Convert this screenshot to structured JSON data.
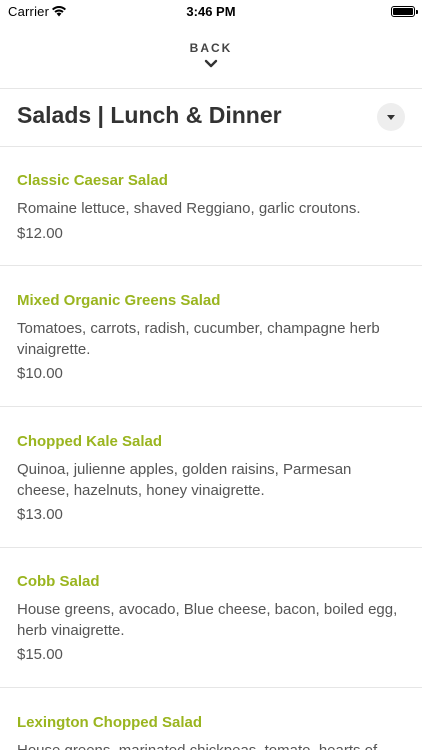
{
  "status_bar": {
    "carrier": "Carrier",
    "time": "3:46 PM"
  },
  "nav": {
    "back_label": "BACK"
  },
  "section": {
    "title": "Salads | Lunch & Dinner"
  },
  "menu_items": [
    {
      "name": "Classic Caesar Salad",
      "description": "Romaine lettuce, shaved Reggiano, garlic croutons.",
      "price": "$12.00"
    },
    {
      "name": "Mixed Organic Greens Salad",
      "description": "Tomatoes, carrots, radish, cucumber, champagne herb vinaigrette.",
      "price": "$10.00"
    },
    {
      "name": "Chopped Kale Salad",
      "description": "Quinoa, julienne apples, golden raisins, Parmesan cheese, hazelnuts, honey vinaigrette.",
      "price": "$13.00"
    },
    {
      "name": "Cobb Salad",
      "description": "House greens, avocado, Blue cheese, bacon, boiled egg, herb vinaigrette.",
      "price": "$15.00"
    },
    {
      "name": "Lexington Chopped Salad",
      "description": "House greens, marinated chickpeas, tomato, hearts of"
    }
  ],
  "colors": {
    "item_name": "#9ab51f",
    "text": "#555555",
    "divider": "#e6e6e6"
  }
}
